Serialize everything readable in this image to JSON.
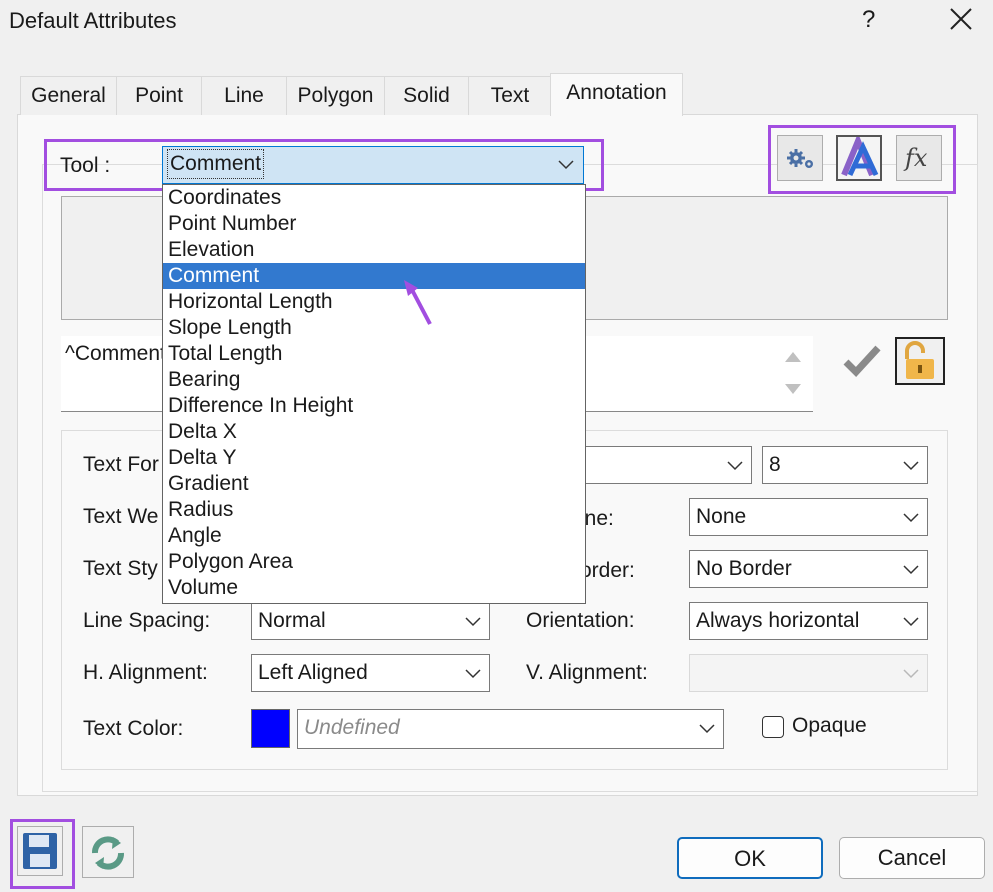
{
  "window": {
    "title": "Default Attributes",
    "help_label": "?"
  },
  "tabs": [
    "General",
    "Point",
    "Line",
    "Polygon",
    "Solid",
    "Text",
    "Annotation"
  ],
  "active_tab": "Annotation",
  "tool": {
    "label": "Tool :",
    "value": "Comment",
    "options": [
      "Coordinates",
      "Point Number",
      "Elevation",
      "Comment",
      "Horizontal Length",
      "Slope Length",
      "Total Length",
      "Bearing",
      "Difference In Height",
      "Delta X",
      "Delta Y",
      "Gradient",
      "Radius",
      "Angle",
      "Polygon Area",
      "Volume"
    ],
    "selected_index": 3
  },
  "toolbar_icons": [
    "gears-icon",
    "font-icon",
    "function-fx-icon"
  ],
  "expression_text": "^Comment",
  "form": {
    "text_font_label": "Text For",
    "text_size": "8",
    "text_weight_label": "Text We",
    "underline_label": "ine:",
    "underline_value": "None",
    "text_style_label": "Text Sty",
    "border_label": "order:",
    "border_value": "No Border",
    "line_spacing_label": "Line Spacing:",
    "line_spacing_value": "Normal",
    "orientation_label": "Orientation:",
    "orientation_value": "Always horizontal",
    "h_alignment_label": "H. Alignment:",
    "h_alignment_value": "Left Aligned",
    "v_alignment_label": "V. Alignment:",
    "v_alignment_value": "",
    "text_color_label": "Text Color:",
    "text_color_value": "Undefined",
    "text_color_swatch": "#0000ff",
    "opaque_label": "Opaque",
    "opaque_checked": false
  },
  "buttons": {
    "ok": "OK",
    "cancel": "Cancel"
  },
  "colors": {
    "highlight": "#a24ee0",
    "selection": "#3279cf",
    "accent": "#0f6cbd"
  }
}
